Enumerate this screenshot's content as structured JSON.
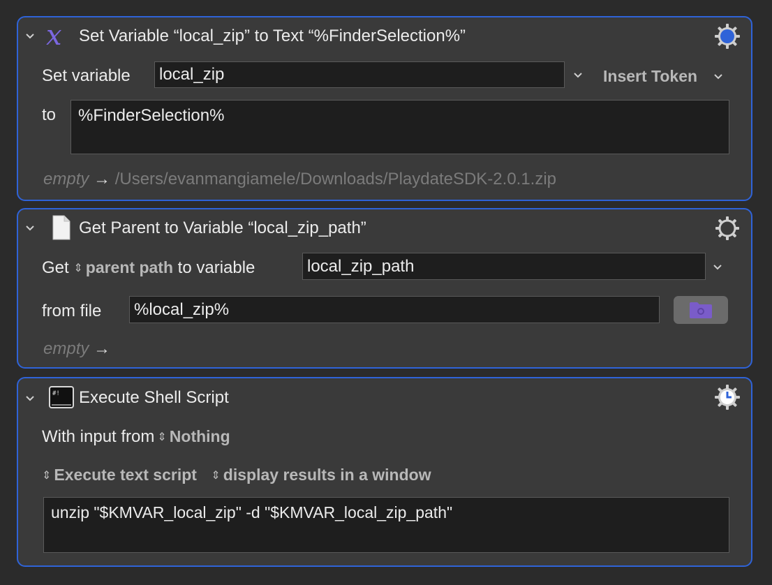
{
  "actions": [
    {
      "title": "Set Variable “local_zip” to Text “%FinderSelection%”",
      "set_variable_label": "Set variable",
      "variable_value": "local_zip",
      "insert_token_label": "Insert Token",
      "to_label": "to",
      "text_value": "%FinderSelection%",
      "preview_empty": "empty",
      "preview_arrow": "→",
      "preview_value": "/Users/evanmangiamele/Downloads/PlaydateSDK-2.0.1.zip"
    },
    {
      "title": "Get Parent to Variable “local_zip_path”",
      "get_label": "Get",
      "mode_value": "parent path",
      "to_variable_label": "to variable",
      "variable_value": "local_zip_path",
      "from_file_label": "from file",
      "file_value": "%local_zip%",
      "preview_empty": "empty",
      "preview_arrow": "→"
    },
    {
      "title": "Execute Shell Script",
      "input_label": "With input from",
      "input_value": "Nothing",
      "execute_mode": "Execute text script",
      "output_mode": "display results in a window",
      "script_value": "unzip \"$KMVAR_local_zip\" -d \"$KMVAR_local_zip_path\""
    }
  ],
  "icons": {
    "variable": "variable-x-icon",
    "file": "document-icon",
    "terminal": "terminal-icon",
    "gear": "gear-icon",
    "folder": "folder-gear-icon"
  },
  "colors": {
    "accent": "#2f63d8",
    "panel": "#3a3a3a",
    "field": "#1e1e1e",
    "purple": "#7a5cc9"
  }
}
